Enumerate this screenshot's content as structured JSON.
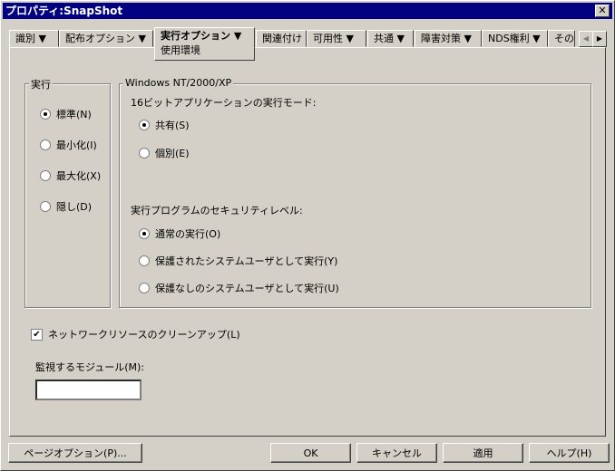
{
  "window": {
    "title": "プロパティ:SnapShot",
    "close": "✕"
  },
  "tabs": [
    {
      "label": "識別 ▼"
    },
    {
      "label": "配布オプション ▼"
    },
    {
      "label": "実行オプション ▼",
      "sub": "使用環境"
    },
    {
      "label": "関連付け"
    },
    {
      "label": "可用性 ▼"
    },
    {
      "label": "共通 ▼"
    },
    {
      "label": "障害対策 ▼"
    },
    {
      "label": "NDS権利 ▼"
    },
    {
      "label": "その"
    }
  ],
  "tab_scroll": {
    "left": "◀",
    "right": "▶"
  },
  "run_group": {
    "title": "実行",
    "options": [
      "標準(N)",
      "最小化(I)",
      "最大化(X)",
      "隠し(D)"
    ],
    "selected": 0
  },
  "nt_group": {
    "title": "Windows NT/2000/XP",
    "mode_label": "16ビットアプリケーションの実行モード:",
    "mode_options": [
      "共有(S)",
      "個別(E)"
    ],
    "mode_selected": 0,
    "sec_label": "実行プログラムのセキュリティレベル:",
    "sec_options": [
      "通常の実行(O)",
      "保護されたシステムユーザとして実行(Y)",
      "保護なしのシステムユーザとして実行(U)"
    ],
    "sec_selected": 0
  },
  "cleanup": {
    "label": "ネットワークリソースのクリーンアップ(L)",
    "checked": true,
    "mark": "✔"
  },
  "module": {
    "label": "監視するモジュール(M):",
    "value": ""
  },
  "buttons": {
    "page_options": "ページオプション(P)...",
    "ok": "OK",
    "cancel": "キャンセル",
    "apply": "適用",
    "help": "ヘルプ(H)"
  }
}
